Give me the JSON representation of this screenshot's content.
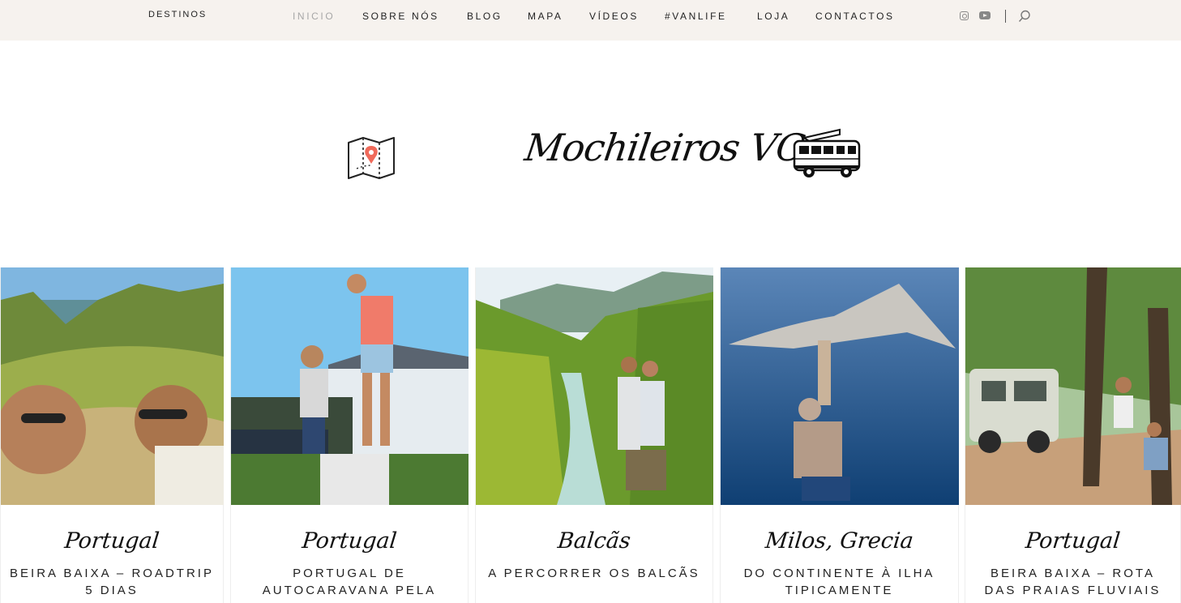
{
  "nav": {
    "destinos": "DESTINOS",
    "items": [
      "INICIO",
      "SOBRE NÓS",
      "BLOG",
      "MAPA",
      "VÍDEOS",
      "#VANLIFE",
      "LOJA",
      "CONTACTOS"
    ]
  },
  "icons": {
    "instagram": "instagram-icon",
    "youtube": "youtube-icon",
    "search": "search-icon",
    "map": "map-pin-icon",
    "van": "camper-van-icon"
  },
  "brand": {
    "name": "Mochileiros VC"
  },
  "colors": {
    "topbar": "#f6f2ee",
    "active_nav": "#a7a7a7",
    "map_pin": "#f06a5a"
  },
  "cards": [
    {
      "category": "Portugal",
      "title": "BEIRA BAIXA – ROADTRIP 5 DIAS"
    },
    {
      "category": "Portugal",
      "title": "PORTUGAL DE AUTOCARAVANA PELA"
    },
    {
      "category": "Balcãs",
      "title": "A PERCORRER OS BALCÃS"
    },
    {
      "category": "Milos, Grecia",
      "title": "DO CONTINENTE À ILHA TIPICAMENTE"
    },
    {
      "category": "Portugal",
      "title": "BEIRA BAIXA – ROTA DAS PRAIAS FLUVIAIS"
    }
  ]
}
